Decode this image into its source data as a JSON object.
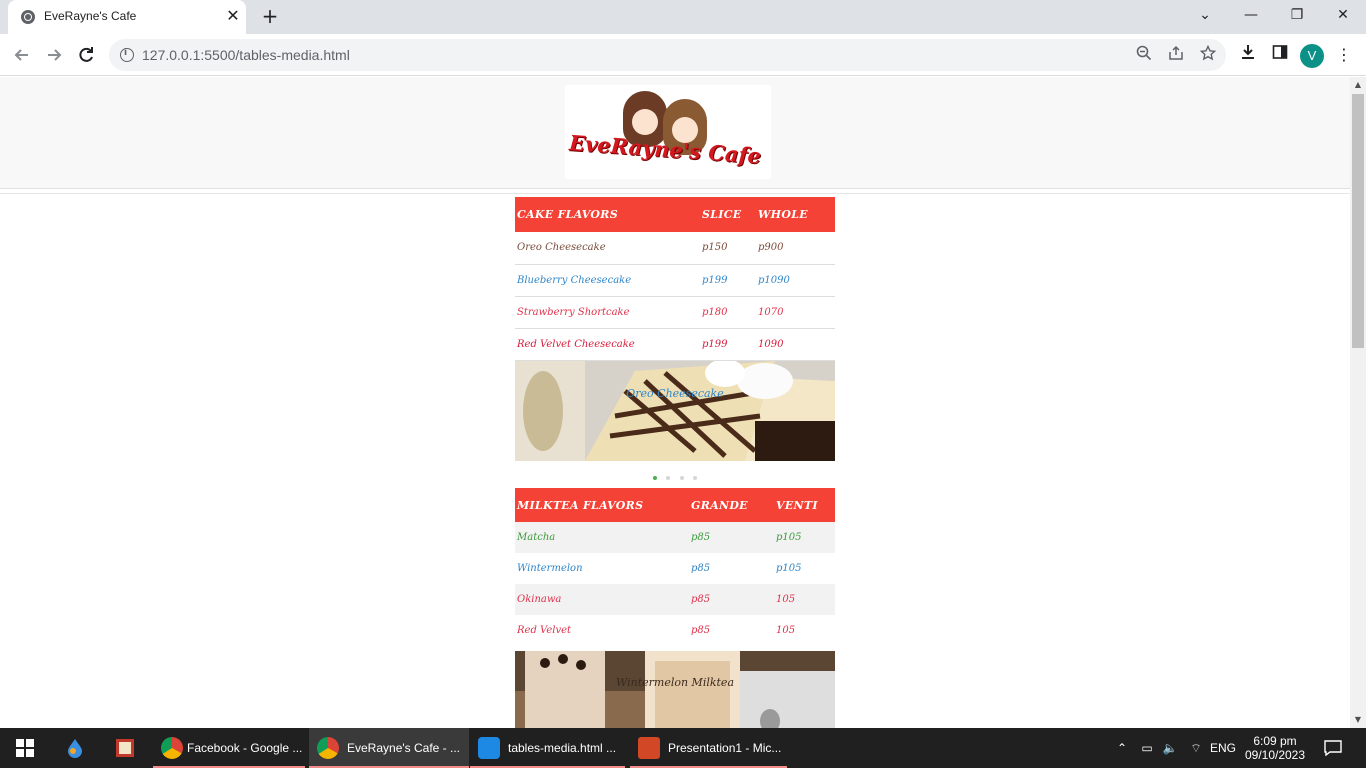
{
  "browser": {
    "tab_title": "EveRayne's Cafe",
    "url": "127.0.0.1:5500/tables-media.html",
    "profile_initial": "V",
    "icons": {
      "back": "arrow-left",
      "forward": "arrow-right",
      "reload": "reload",
      "zoom": "zoom-out",
      "share": "share",
      "bookmark": "star",
      "downloads": "download",
      "side_panel": "side-panel",
      "menu": "kebab-menu"
    }
  },
  "site": {
    "logo_text": "EveRayne's Cafe",
    "cake_table": {
      "headers": [
        "CAKE FLAVORS",
        "SLICE",
        "WHOLE"
      ],
      "rows": [
        {
          "name": "Oreo Cheesecake",
          "slice": "p150",
          "whole": "p900",
          "color": "#7a4a3a"
        },
        {
          "name": "Blueberry Cheesecake",
          "slice": "p199",
          "whole": "p1090",
          "color": "#2f86c9"
        },
        {
          "name": "Strawberry Shortcake",
          "slice": "p180",
          "whole": "1070",
          "color": "#e0314a"
        },
        {
          "name": "Red Velvet Cheesecake",
          "slice": "p199",
          "whole": "1090",
          "color": "#d81b3c"
        }
      ]
    },
    "cake_slide_caption": "Oreo Cheesecake",
    "milktea_table": {
      "headers": [
        "MILKTEA FLAVORS",
        "GRANDE",
        "VENTI"
      ],
      "rows": [
        {
          "name": "Matcha",
          "grande": "p85",
          "venti": "p105",
          "color": "#3d9a3d"
        },
        {
          "name": "Wintermelon",
          "grande": "p85",
          "venti": "p105",
          "color": "#2f86c9"
        },
        {
          "name": "Okinawa",
          "grande": "p85",
          "venti": "105",
          "color": "#e0314a"
        },
        {
          "name": "Red Velvet",
          "grande": "p85",
          "venti": "105",
          "color": "#e0314a"
        }
      ]
    },
    "milktea_slide_caption": "Wintermelon Milktea",
    "header_color": "#f44336"
  },
  "taskbar": {
    "items": [
      {
        "label": "Facebook - Google ...",
        "app": "chrome"
      },
      {
        "label": "EveRayne's Cafe - ...",
        "app": "chrome"
      },
      {
        "label": "tables-media.html ...",
        "app": "vscode"
      },
      {
        "label": "Presentation1 - Mic...",
        "app": "powerpoint"
      }
    ],
    "language": "ENG",
    "time": "6:09 pm",
    "date": "09/10/2023"
  }
}
